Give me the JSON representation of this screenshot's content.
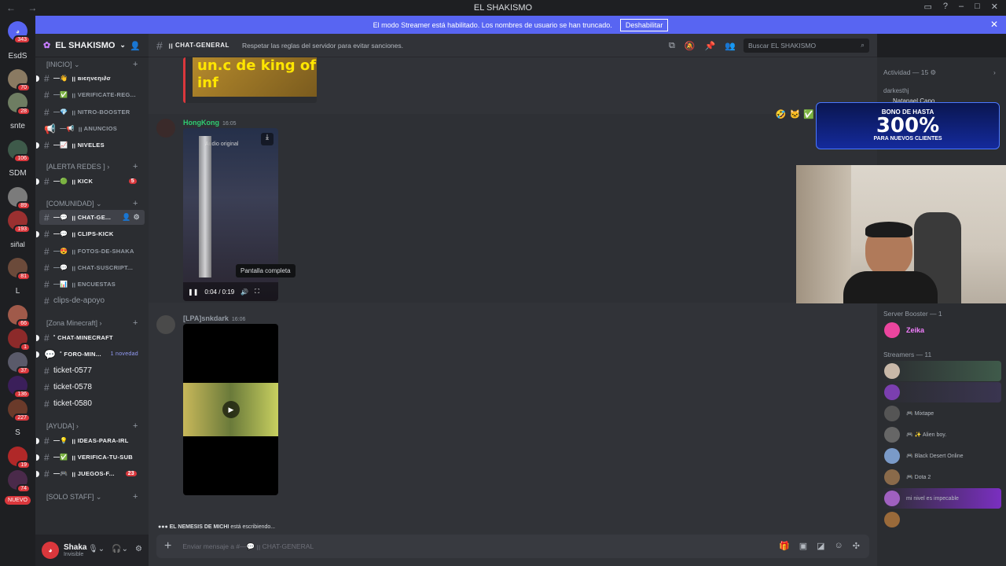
{
  "titlebar": {
    "title": "EL SHAKISMO",
    "back": "←",
    "forward": "→"
  },
  "banner": {
    "text": "El modo Streamer está habilitado. Los nombres de usuario se han truncado.",
    "button": "Deshabilitar"
  },
  "guilds": [
    {
      "label": "",
      "badge": "343"
    },
    {
      "label": "EsdS",
      "badge": ""
    },
    {
      "label": "",
      "badge": "70"
    },
    {
      "label": "",
      "badge": "28"
    },
    {
      "label": "snte",
      "badge": ""
    },
    {
      "label": "",
      "badge": "106"
    },
    {
      "label": "SDM",
      "badge": ""
    },
    {
      "label": "",
      "badge": "89"
    },
    {
      "label": "",
      "badge": "193"
    },
    {
      "label": "siñal",
      "badge": ""
    },
    {
      "label": "",
      "badge": "81"
    },
    {
      "label": "L",
      "badge": ""
    },
    {
      "label": "",
      "badge": "66"
    },
    {
      "label": "",
      "badge": "1"
    },
    {
      "label": "",
      "badge": "37"
    },
    {
      "label": "",
      "badge": "136"
    },
    {
      "label": "",
      "badge": "227"
    },
    {
      "label": "S",
      "badge": ""
    },
    {
      "label": "",
      "badge": "19"
    },
    {
      "label": "",
      "badge": "74"
    },
    {
      "label": "NUEVO",
      "badge": ""
    }
  ],
  "server": {
    "name": "EL SHAKISMO"
  },
  "categories": {
    "inicio": "[INICIO]",
    "alerta": "[ALERTA REDES ]",
    "comunidad": "[COMUNIDAD]",
    "minecraft": "[Zona Minecraft]",
    "ayuda": "[AYUDA]",
    "staff": "[SOLO STAFF]"
  },
  "channels": {
    "bienvenido": "ꞁꞁ вιєηνєηι∂σ",
    "verificate": "ꞁꞁ VERIFICATE-REG...",
    "nitro": "ꞁꞁ NITRO-BOOSTER",
    "anuncios": "ꞁꞁ ANUNCIOS",
    "niveles": "ꞁꞁ NIVELES",
    "kick": "ꞁꞁ KICK",
    "kick_badge": "5",
    "chat_general": "ꞁꞁ CHAT-GE...",
    "clips_kick": "ꞁꞁ CLIPS-KICK",
    "fotos": "ꞁꞁ FOTOS-DE-SHAKA",
    "chat_suscript": "ꞁꞁ CHAT-SUSCRIPT...",
    "encuestas": "ꞁꞁ ENCUESTAS",
    "clips_apoyo": "clips-de-apoyo",
    "chat_minecraft": "˚ CHAT-MINECRAFT",
    "foro_min": "˚ FORO-MIN...",
    "foro_novedad": "1 novedad",
    "ticket1": "ticket-0577",
    "ticket2": "ticket-0578",
    "ticket3": "ticket-0580",
    "ideas": "ꞁꞁ IDEAS-PARA-IRL",
    "verifica_sub": "ꞁꞁ VERIFICA-TU-SUB",
    "juegos": "ꞁꞁ JUEGOS-F...",
    "juegos_badge": "23"
  },
  "user": {
    "name": "Shaka",
    "status": "Invisible"
  },
  "header": {
    "channel": "ꞁꞁ CHAT-GENERAL",
    "topic": "Respetar las reglas del servidor para evitar sanciones.",
    "search_placeholder": "Buscar EL SHAKISMO"
  },
  "messages": {
    "top_embed_text": "un.c de king of inf",
    "m1_author": "HongKong",
    "m1_time": "16:05",
    "m1_video_time": "0:04 / 0:19",
    "m1_tooltip": "Pantalla completa",
    "m1_overlay": "Audio original",
    "m2_author": "[LPA]snkdark",
    "m2_time": "16:06",
    "typing_user": "EL NEMESIS DE MICHI",
    "typing_text": "está escribiendo..."
  },
  "composer": {
    "placeholder": "Enviar mensaje a #—💬 ꞁꞁ CHAT-GENERAL"
  },
  "members": {
    "activity": "Actividad — 15",
    "activity_user": "darkesthj",
    "activity_user2": "Natanael Cano",
    "booster_cat": "Server Booster — 1",
    "booster_user": "Zeika",
    "streamers_cat": "Streamers — 11",
    "streamers": [
      {
        "name": "",
        "activity": ""
      },
      {
        "name": "",
        "activity": ""
      },
      {
        "name": "",
        "activity": "🎮 Mixtape"
      },
      {
        "name": "",
        "activity": "🎮 ✨ Alien boy."
      },
      {
        "name": "",
        "activity": "🎮 Black Desert Online"
      },
      {
        "name": "",
        "activity": "🎮 Dota 2"
      },
      {
        "name": "",
        "activity": "mi nivel es impecable"
      },
      {
        "name": "",
        "activity": ""
      }
    ]
  },
  "ad": {
    "line1": "BONO DE HASTA",
    "line2": "300%",
    "line3": "PARA NUEVOS CLIENTES"
  },
  "colors": {
    "accent": "#5865f2",
    "danger": "#da373c",
    "streamer_name": "#a855f7"
  }
}
